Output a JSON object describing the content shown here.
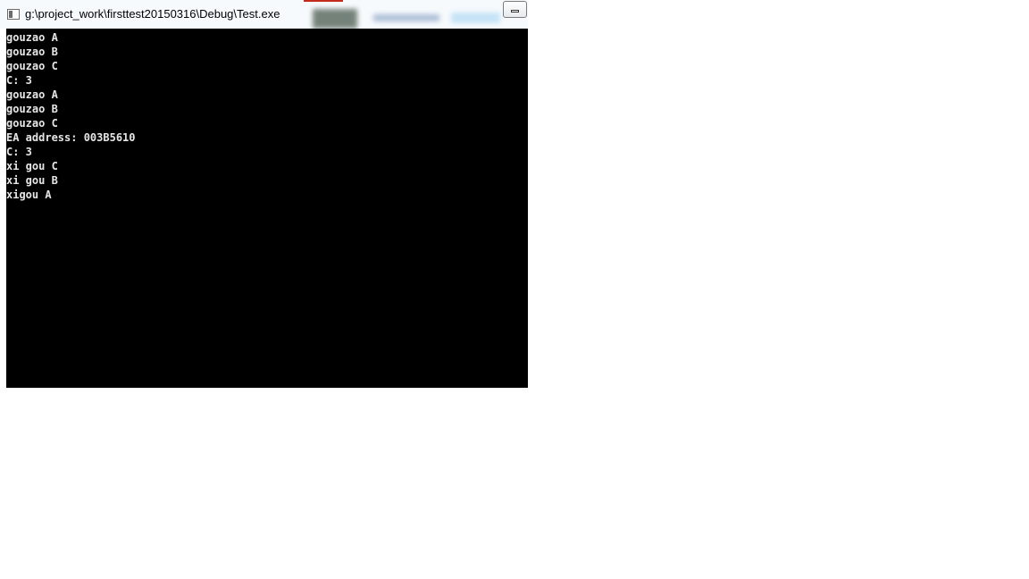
{
  "window": {
    "title": "g:\\project_work\\firsttest20150316\\Debug\\Test.exe",
    "icon": "console-app-icon",
    "controls": {
      "minimize_icon": "minimize-icon"
    }
  },
  "console": {
    "background": "#000000",
    "foreground": "#e6e6e6",
    "lines": [
      "gouzao A",
      "gouzao B",
      "gouzao C",
      "C: 3",
      "gouzao A",
      "gouzao B",
      "gouzao C",
      "EA address: 003B5610",
      "C: 3",
      "xi gou C",
      "xi gou B",
      "xigou A"
    ]
  }
}
